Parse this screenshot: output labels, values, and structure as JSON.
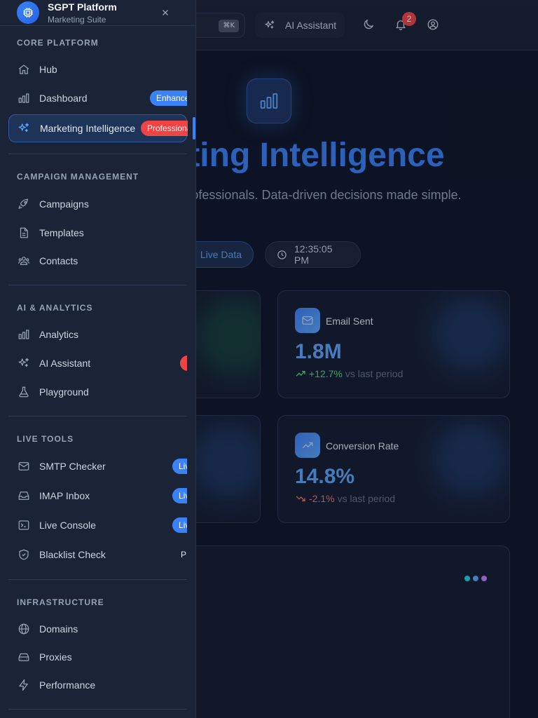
{
  "app": {
    "name": "SGPT Platform",
    "subtitle": "Marketing Suite"
  },
  "topbar": {
    "search_shortcut": "⌘K",
    "ai_button_label": "AI Assistant",
    "notification_count": "2"
  },
  "hero": {
    "title": "Marketing Intelligence",
    "title_visible": "ting Intelligence",
    "subtitle": "rtics for marketing professionals. Data-driven decisions made simple.",
    "live_label": "Live Data",
    "time": "12:35:05 PM"
  },
  "stats": [
    {
      "label": "Email Sent",
      "value": "1.8M",
      "change": "+12.7%",
      "suffix": "vs last period",
      "trend": "up",
      "color": "#4ade80"
    },
    {
      "label": "Conversion Rate",
      "value": "14.8%",
      "change": "-2.1%",
      "suffix": "vs last period",
      "trend": "down",
      "color": "#f87171"
    }
  ],
  "colors": {
    "accent": "#3b82f6",
    "danger": "#ef4444",
    "success": "#4ade80",
    "dot_cyan": "#22d3ee",
    "dot_blue": "#60a5fa",
    "dot_purple": "#c084fc"
  },
  "sidebar": {
    "sections": [
      {
        "title": "CORE PLATFORM",
        "items": [
          {
            "label": "Hub",
            "icon": "home-icon"
          },
          {
            "label": "Dashboard",
            "icon": "bar-chart-icon",
            "badge": "Enhanced"
          },
          {
            "label": "Marketing Intelligence",
            "icon": "sparkles-icon",
            "badge": "Professional",
            "active": true
          }
        ]
      },
      {
        "title": "CAMPAIGN MANAGEMENT",
        "items": [
          {
            "label": "Campaigns",
            "icon": "rocket-icon"
          },
          {
            "label": "Templates",
            "icon": "file-icon"
          },
          {
            "label": "Contacts",
            "icon": "users-icon"
          }
        ]
      },
      {
        "title": "AI & ANALYTICS",
        "items": [
          {
            "label": "Analytics",
            "icon": "bar-chart-icon"
          },
          {
            "label": "AI Assistant",
            "icon": "sparkles-icon"
          },
          {
            "label": "Playground",
            "icon": "flask-icon"
          }
        ]
      },
      {
        "title": "LIVE TOOLS",
        "items": [
          {
            "label": "SMTP Checker",
            "icon": "mail-icon",
            "badge": "Live"
          },
          {
            "label": "IMAP Inbox",
            "icon": "inbox-icon",
            "badge": "Live"
          },
          {
            "label": "Live Console",
            "icon": "terminal-icon",
            "badge": "Live"
          },
          {
            "label": "Blacklist Check",
            "icon": "shield-check-icon",
            "badge": "P"
          }
        ]
      },
      {
        "title": "INFRASTRUCTURE",
        "items": [
          {
            "label": "Domains",
            "icon": "globe-icon"
          },
          {
            "label": "Proxies",
            "icon": "server-icon"
          },
          {
            "label": "Performance",
            "icon": "zap-icon"
          }
        ]
      }
    ]
  }
}
